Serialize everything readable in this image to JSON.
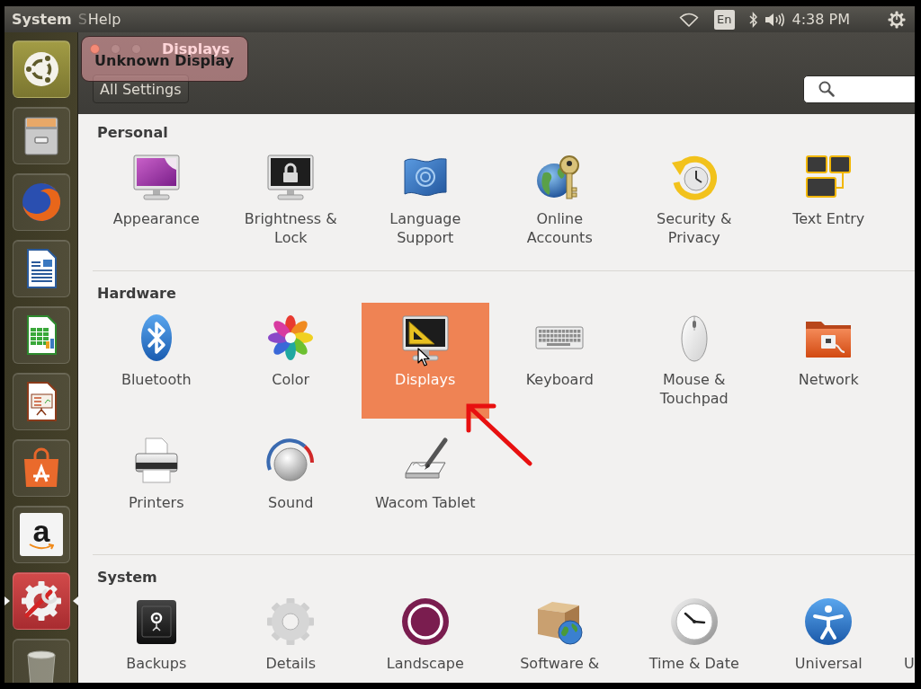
{
  "top_panel": {
    "app_name": "System",
    "menus": [
      {
        "label": "S",
        "faded": true
      },
      {
        "label": "Help",
        "faded": false
      }
    ],
    "keyboard_layout": "En",
    "clock": "4:38 PM"
  },
  "launcher": {
    "items": [
      {
        "active": false
      },
      {
        "active": false
      },
      {
        "active": false
      },
      {
        "active": false
      },
      {
        "active": false
      },
      {
        "active": false
      },
      {
        "active": false
      },
      {
        "active": false,
        "glyph": "a"
      },
      {
        "active": true
      },
      {
        "active": false
      }
    ]
  },
  "window": {
    "title": "Displays",
    "tooltip": "Unknown Display",
    "back_button": "All Settings"
  },
  "sections": [
    {
      "title": "Personal",
      "items": [
        {
          "label": "Appearance",
          "selected": false
        },
        {
          "label": "Brightness & Lock",
          "selected": false
        },
        {
          "label": "Language Support",
          "selected": false
        },
        {
          "label": "Online Accounts",
          "selected": false
        },
        {
          "label": "Security & Privacy",
          "selected": false
        },
        {
          "label": "Text Entry",
          "selected": false
        }
      ]
    },
    {
      "title": "Hardware",
      "items": [
        {
          "label": "Bluetooth",
          "selected": false
        },
        {
          "label": "Color",
          "selected": false
        },
        {
          "label": "Displays",
          "selected": true
        },
        {
          "label": "Keyboard",
          "selected": false
        },
        {
          "label": "Mouse & Touchpad",
          "selected": false
        },
        {
          "label": "Network",
          "selected": false
        },
        {
          "label": "Printers",
          "selected": false
        },
        {
          "label": "Sound",
          "selected": false
        },
        {
          "label": "Wacom Tablet",
          "selected": false
        }
      ]
    },
    {
      "title": "System",
      "items": [
        {
          "label": "Backups",
          "selected": false
        },
        {
          "label": "Details",
          "selected": false
        },
        {
          "label": "Landscape",
          "selected": false
        },
        {
          "label": "Software &",
          "selected": false
        },
        {
          "label": "Time & Date",
          "selected": false
        },
        {
          "label": "Universal",
          "selected": false
        }
      ],
      "clipped_label": "U"
    }
  ]
}
